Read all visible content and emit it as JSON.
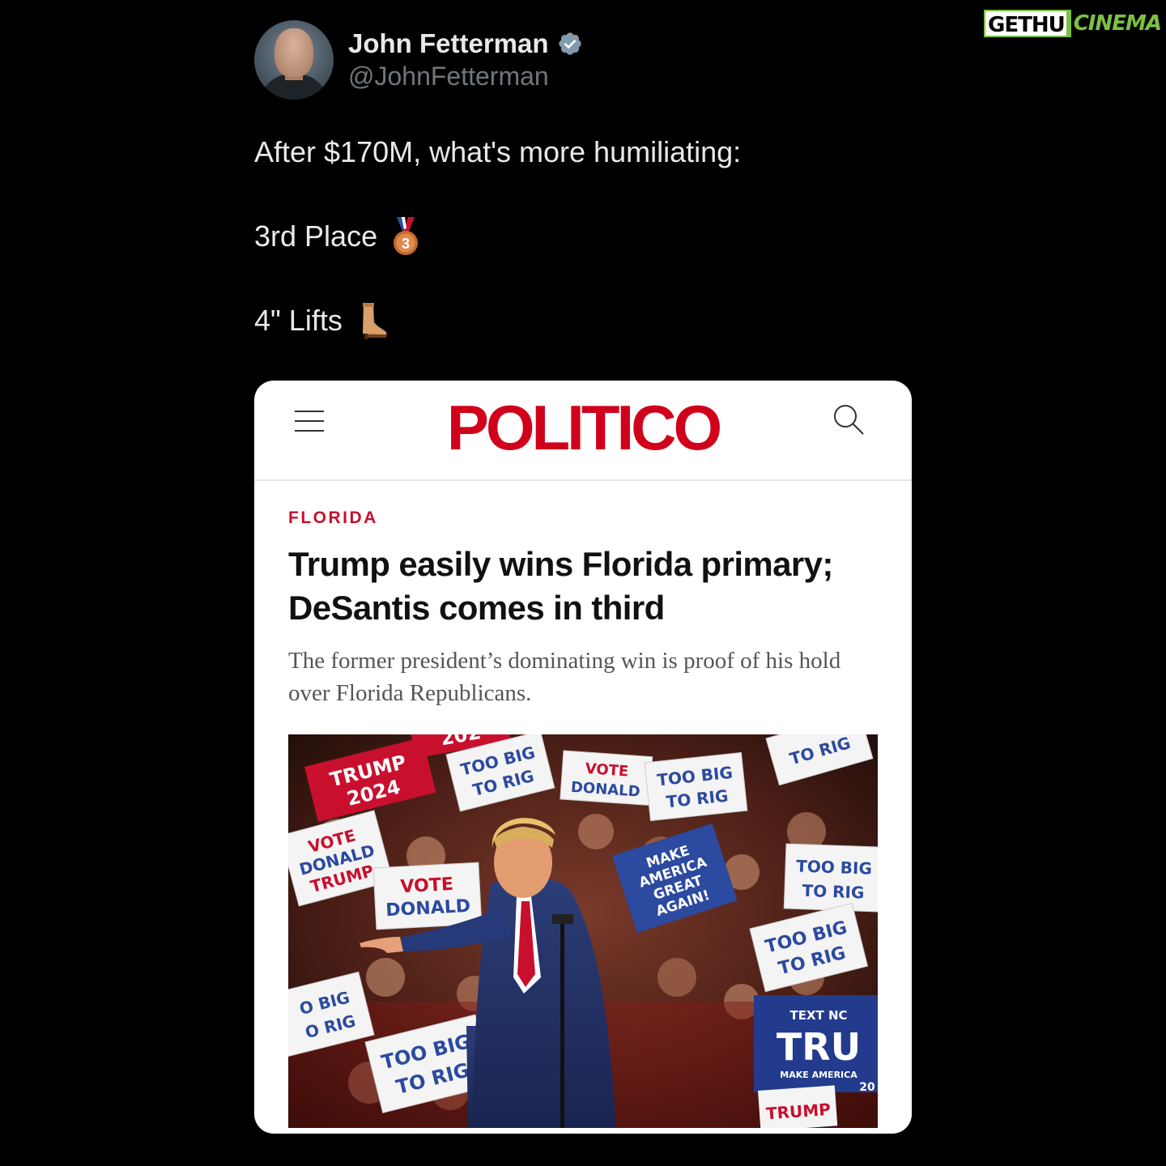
{
  "watermark": {
    "part_a": "GETHU",
    "part_b": "CINEMA"
  },
  "tweet": {
    "display_name": "John Fetterman",
    "handle": "@JohnFetterman",
    "verified": true,
    "lines": [
      "After $170M, what's more humiliating:",
      "3rd Place",
      "4\" Lifts"
    ],
    "line_emojis": [
      "3rd-place-medal-icon",
      "boot-icon"
    ]
  },
  "article_card": {
    "publication": "POLITICO",
    "section": "FLORIDA",
    "headline": "Trump easily wins Florida primary; DeSantis comes in third",
    "dek": "The former president’s dominating win is proof of his hold over Florida Republicans.",
    "photo_signs": [
      "TRUMP 2024",
      "TOO BIG TO RIG",
      "VOTE DONALD TRUMP",
      "MAKE AMERICA GREAT AGAIN!",
      "TEXT NC",
      "TRU",
      "MAKE AMERICA",
      "20",
      "TRUMP",
      "202"
    ]
  },
  "colors": {
    "background": "#000000",
    "text_primary": "#e7e9ea",
    "text_secondary": "#71767b",
    "verified_badge": "#829aab",
    "politico_red": "#d0021b",
    "watermark_green": "#7ac143"
  }
}
